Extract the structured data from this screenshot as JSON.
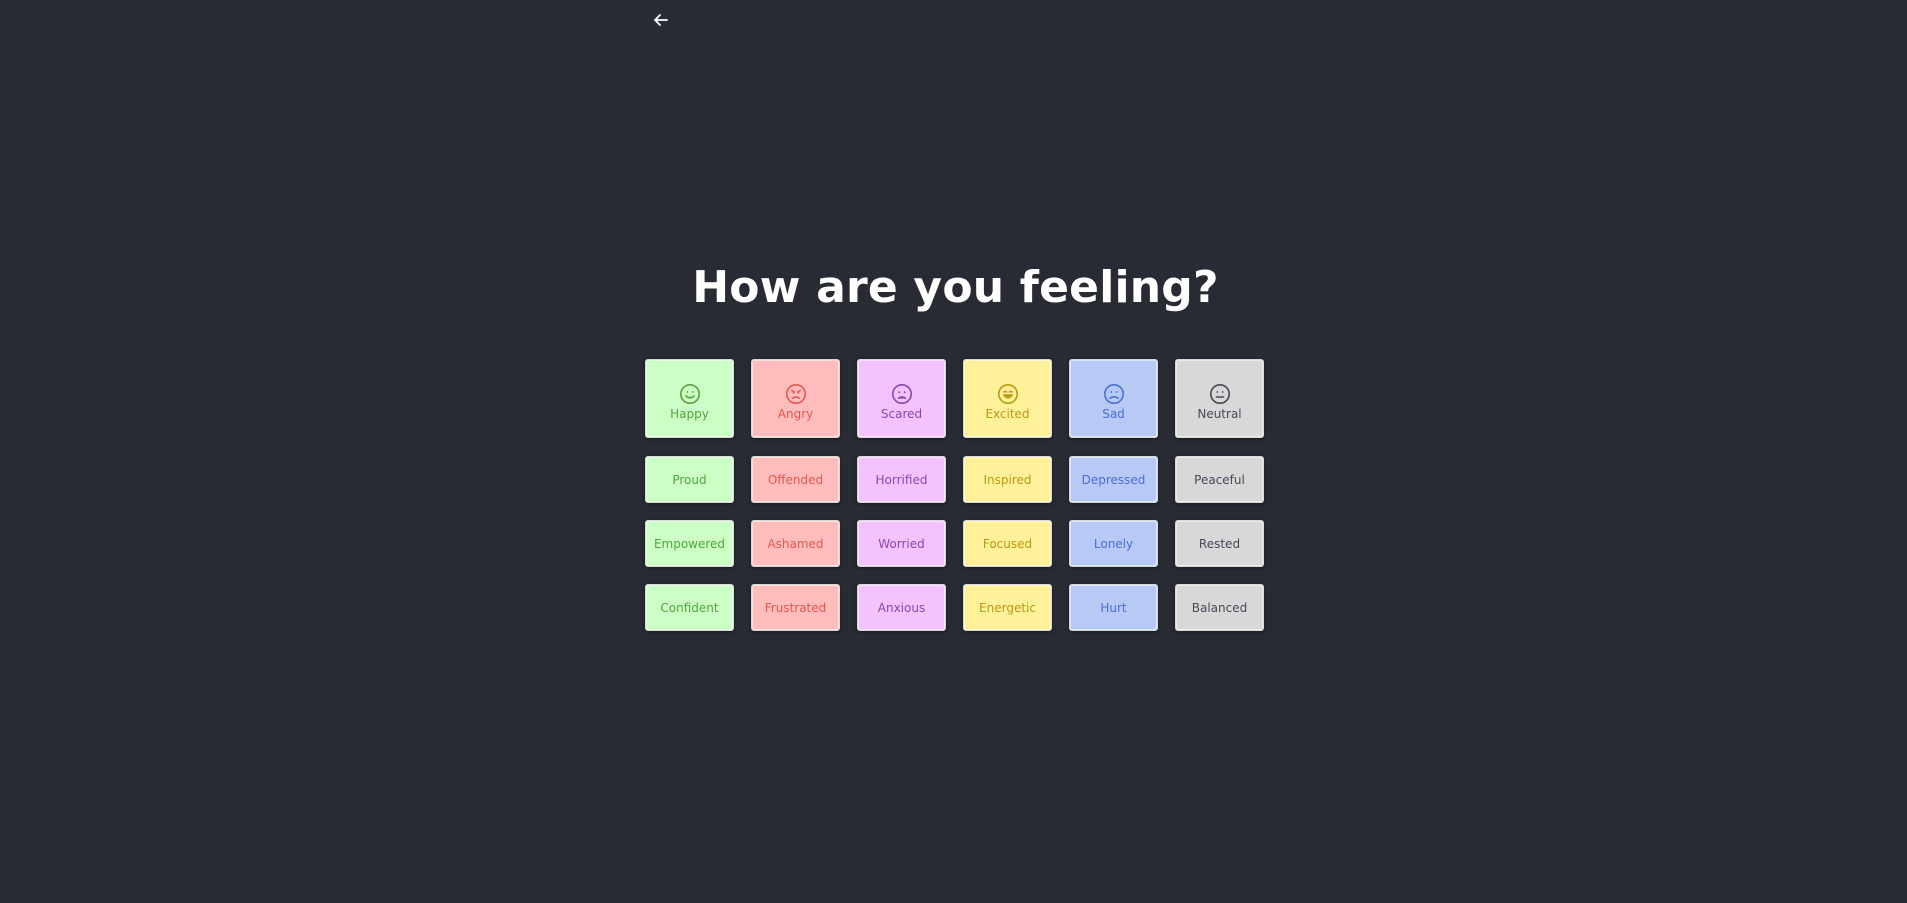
{
  "title": "How are you feeling?",
  "back_icon": "arrow-left-icon",
  "emotions": [
    {
      "key": "happy",
      "label": "Happy",
      "icon": "smile-icon",
      "bg": "#ccffc5",
      "fg": "#55a23f",
      "subs": [
        "Proud",
        "Empowered",
        "Confident"
      ]
    },
    {
      "key": "angry",
      "label": "Angry",
      "icon": "angry-face-icon",
      "bg": "#ffbcbc",
      "fg": "#e0584f",
      "subs": [
        "Offended",
        "Ashamed",
        "Frustrated"
      ]
    },
    {
      "key": "scared",
      "label": "Scared",
      "icon": "scared-face-icon",
      "bg": "#f4c2ff",
      "fg": "#8c48a6",
      "subs": [
        "Horrified",
        "Worried",
        "Anxious"
      ]
    },
    {
      "key": "excited",
      "label": "Excited",
      "icon": "grin-face-icon",
      "bg": "#fff09a",
      "fg": "#b89a12",
      "subs": [
        "Inspired",
        "Focused",
        "Energetic"
      ]
    },
    {
      "key": "sad",
      "label": "Sad",
      "icon": "frown-face-icon",
      "bg": "#b8c9f5",
      "fg": "#4a6fcf",
      "subs": [
        "Depressed",
        "Lonely",
        "Hurt"
      ]
    },
    {
      "key": "neutral",
      "label": "Neutral",
      "icon": "neutral-face-icon",
      "bg": "#d8d8d8",
      "fg": "#444a57",
      "subs": [
        "Peaceful",
        "Rested",
        "Balanced"
      ]
    }
  ]
}
